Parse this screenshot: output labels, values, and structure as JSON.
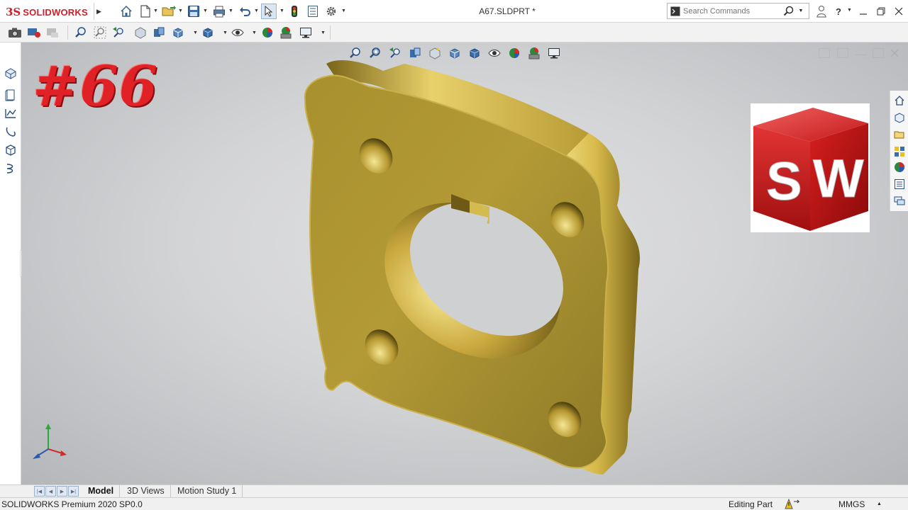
{
  "app": {
    "brand_mark": "3S",
    "brand_name": "SOLIDWORKS",
    "document_title": "A67.SLDPRT *"
  },
  "titlebar": {
    "icons": [
      "home-icon",
      "new-document-icon",
      "open-folder-icon",
      "save-icon",
      "print-icon",
      "undo-icon",
      "select-arrow-icon",
      "rebuild-traffic-light-icon",
      "file-properties-icon",
      "options-gear-icon"
    ],
    "search_placeholder": "Search Commands",
    "help_label": "?",
    "window_icons": [
      "user-icon",
      "help-icon",
      "minimize-icon",
      "restore-icon",
      "close-icon"
    ]
  },
  "command_bar": {
    "icons": [
      "camera-icon",
      "record-icon",
      "record-gray-icon",
      "zoom-to-fit-icon",
      "zoom-area-icon",
      "previous-view-icon",
      "section-view-icon",
      "dynamic-annotation-icon",
      "view-orientation-icon",
      "display-style-icon",
      "hide-show-icon",
      "edit-appearance-icon",
      "apply-scene-icon",
      "view-settings-icon"
    ]
  },
  "left_strip": {
    "icons": [
      "feature-manager-icon",
      "property-manager-icon",
      "configuration-manager-icon",
      "dimxpert-icon",
      "display-manager-icon",
      "cam-icon"
    ]
  },
  "viewport": {
    "overlay_text": "#66",
    "headsup_icons": [
      "zoom-to-fit-icon",
      "zoom-area-icon",
      "previous-view-icon",
      "section-view-icon",
      "dynamic-annotation-icon",
      "view-orientation-icon",
      "display-style-icon",
      "hide-show-icon",
      "edit-appearance-icon",
      "apply-scene-icon",
      "view-settings-icon"
    ],
    "sw_logo_letters": "SW",
    "part_color": "#c8a93a",
    "background_color": "#d3d4d6"
  },
  "task_pane": {
    "icons": [
      "solidworks-resources-icon",
      "design-library-icon",
      "file-explorer-icon",
      "view-palette-icon",
      "appearances-icon",
      "custom-properties-icon",
      "forum-icon"
    ]
  },
  "tabs": {
    "items": [
      "Model",
      "3D Views",
      "Motion Study 1"
    ],
    "active": "Model"
  },
  "status": {
    "app_version": "SOLIDWORKS Premium 2020 SP0.0",
    "mode": "Editing Part",
    "units": "MMGS"
  },
  "colors": {
    "brand_red": "#d11f2a",
    "overlay_red": "#e02226",
    "gold": "#c8a93a"
  }
}
